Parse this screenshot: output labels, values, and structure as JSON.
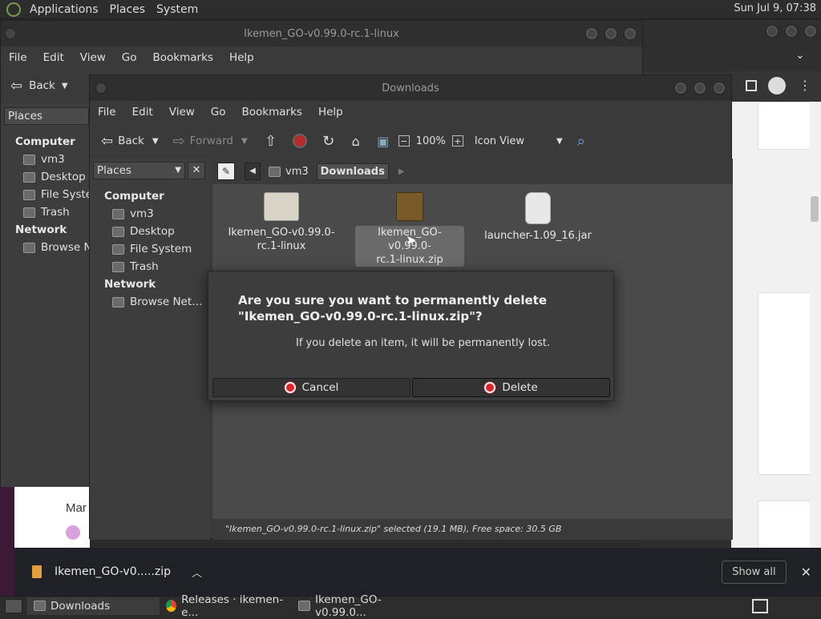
{
  "panel": {
    "applications": "Applications",
    "places": "Places",
    "system": "System",
    "clock": "Sun Jul 9, 07:38"
  },
  "back_window": {
    "title": "Ikemen_GO-v0.99.0-rc.1-linux",
    "menu": [
      "File",
      "Edit",
      "View",
      "Go",
      "Bookmarks",
      "Help"
    ],
    "back_label": "Back",
    "places_label": "Places",
    "sidebar": {
      "computer": "Computer",
      "items": [
        "vm3",
        "Desktop",
        "File System",
        "Trash"
      ],
      "network": "Network",
      "network_items": [
        "Browse Network"
      ]
    }
  },
  "front_window": {
    "title": "Downloads",
    "menu": [
      "File",
      "Edit",
      "View",
      "Go",
      "Bookmarks",
      "Help"
    ],
    "toolbar": {
      "back": "Back",
      "forward": "Forward",
      "zoom": "100%",
      "view": "Icon View"
    },
    "places_label": "Places",
    "sidebar": {
      "computer": "Computer",
      "items": [
        "vm3",
        "Desktop",
        "File System",
        "Trash"
      ],
      "network": "Network",
      "network_items": [
        "Browse Net…"
      ]
    },
    "path": [
      "vm3",
      "Downloads"
    ],
    "files": [
      {
        "name_l1": "Ikemen_GO-v0.99.0-",
        "name_l2": "rc.1-linux",
        "type": "folder"
      },
      {
        "name_l1": "Ikemen_GO-v0.99.0-",
        "name_l2": "rc.1-linux.zip",
        "type": "archive",
        "selected": true
      },
      {
        "name_l1": "launcher-1.09_16.jar",
        "name_l2": "",
        "type": "jar"
      }
    ],
    "status": "\"Ikemen_GO-v0.99.0-rc.1-linux.zip\" selected (19.1 MB), Free space: 30.5 GB"
  },
  "dialog": {
    "question": "Are you sure you want to permanently delete \"Ikemen_GO-v0.99.0-rc.1-linux.zip\"?",
    "detail": "If you delete an item, it will be permanently lost.",
    "cancel": "Cancel",
    "delete": "Delete"
  },
  "browser": {
    "partial_text": "Mar",
    "download_item": "Ikemen_GO-v0.....zip",
    "show_all": "Show all"
  },
  "taskbar": {
    "tasks": [
      "Downloads",
      "Releases · ikemen-e...",
      "Ikemen_GO-v0.99.0..."
    ]
  },
  "colors": {
    "delete_red": "#d9262c",
    "dialog_bg": "#3d3d3d"
  }
}
